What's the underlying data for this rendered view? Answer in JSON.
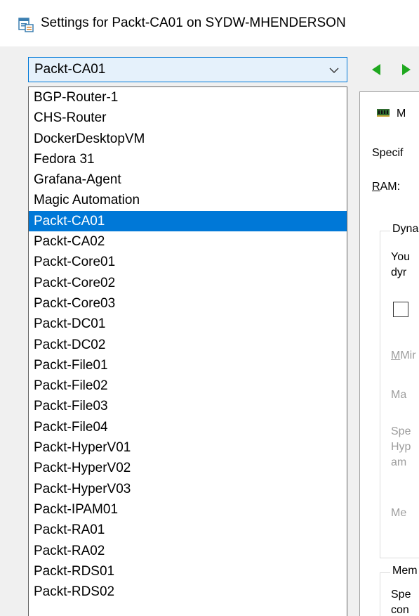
{
  "window": {
    "title": "Settings for Packt-CA01 on SYDW-MHENDERSON"
  },
  "vm_selector": {
    "selected": "Packt-CA01",
    "items": [
      "BGP-Router-1",
      "CHS-Router",
      "DockerDesktopVM",
      "Fedora 31",
      "Grafana-Agent",
      "Magic Automation",
      "Packt-CA01",
      "Packt-CA02",
      "Packt-Core01",
      "Packt-Core02",
      "Packt-Core03",
      "Packt-DC01",
      "Packt-DC02",
      "Packt-File01",
      "Packt-File02",
      "Packt-File03",
      "Packt-File04",
      "Packt-HyperV01",
      "Packt-HyperV02",
      "Packt-HyperV03",
      "Packt-IPAM01",
      "Packt-RA01",
      "Packt-RA02",
      "Packt-RDS01",
      "Packt-RDS02"
    ],
    "selected_index": 6
  },
  "right_panel": {
    "header": "M",
    "specify": "Specif",
    "ram_label": "AM:",
    "ram_accel": "R",
    "dynamic_group": "Dyna",
    "dynamic_line1": "You",
    "dynamic_line2": "dyr",
    "min_label": "Mir",
    "min_accel": "M",
    "max_label": "Ma",
    "spec_line1": "Spe",
    "spec_line2": "Hyp",
    "spec_line3": "am",
    "mem_label": "Me",
    "memory_group": "Mem",
    "memory_line1": "Spe",
    "memory_line2": "con"
  },
  "icons": {
    "title": "settings-window-icon",
    "dropdown": "chevron-down-icon",
    "back": "back-arrow-icon",
    "forward": "forward-arrow-icon",
    "memory": "memory-module-icon"
  },
  "colors": {
    "selection": "#0078d7",
    "combo_bg": "#e5f1fb",
    "nav_arrow": "#1fa81f"
  }
}
